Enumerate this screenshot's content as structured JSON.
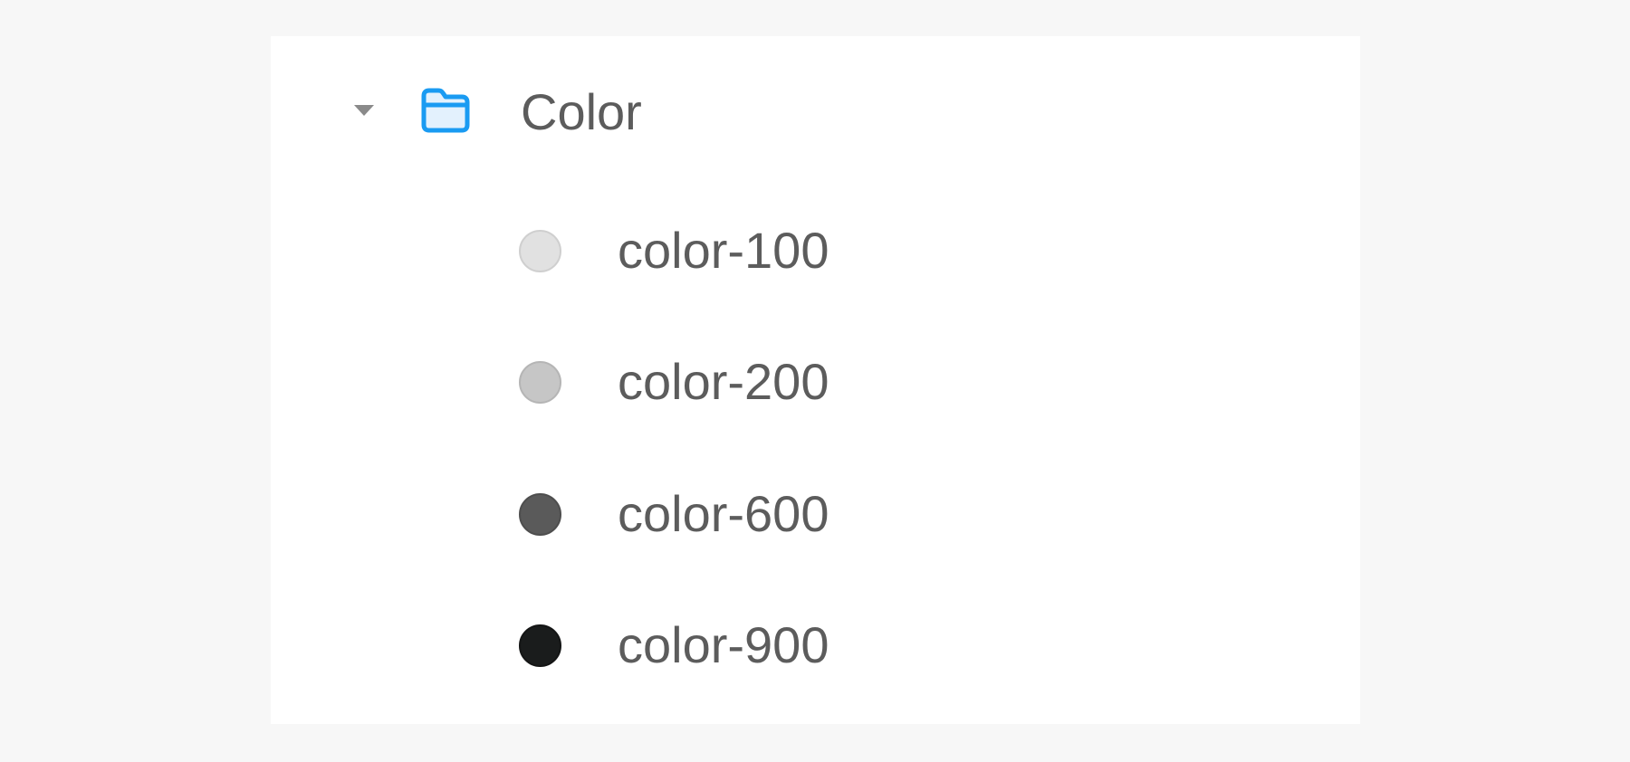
{
  "tree": {
    "folder": {
      "label": "Color",
      "icon": "folder-icon",
      "accent": "#1a9bf2",
      "expanded": true
    },
    "tokens": [
      {
        "label": "color-100",
        "color": "#e1e1e1",
        "border": "#cfcfcf"
      },
      {
        "label": "color-200",
        "color": "#c6c6c6",
        "border": "#b5b5b5"
      },
      {
        "label": "color-600",
        "color": "#5a5a5a",
        "border": "#4e4e4e"
      },
      {
        "label": "color-900",
        "color": "#1a1c1c",
        "border": "#141515"
      }
    ]
  }
}
